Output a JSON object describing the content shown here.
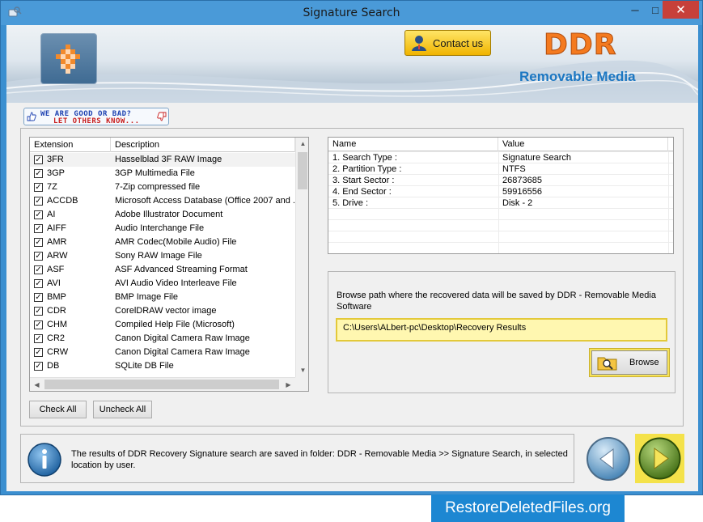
{
  "window": {
    "title": "Signature Search",
    "minimize_glyph": "─",
    "maximize_glyph": "□",
    "close_glyph": "✕"
  },
  "header": {
    "contact_label": "Contact us",
    "brand": "DDR",
    "product": "Removable Media"
  },
  "feedback": {
    "line1": "WE ARE GOOD OR BAD?",
    "line2": "LET OTHERS KNOW..."
  },
  "file_types": {
    "columns": [
      "Extension",
      "Description"
    ],
    "rows": [
      {
        "ext": "3FR",
        "desc": "Hasselblad 3F RAW Image",
        "checked": true
      },
      {
        "ext": "3GP",
        "desc": "3GP Multimedia File",
        "checked": true
      },
      {
        "ext": "7Z",
        "desc": "7-Zip compressed file",
        "checked": true
      },
      {
        "ext": "ACCDB",
        "desc": "Microsoft Access Database (Office 2007 and ...",
        "checked": true
      },
      {
        "ext": "AI",
        "desc": "Adobe Illustrator Document",
        "checked": true
      },
      {
        "ext": "AIFF",
        "desc": "Audio Interchange File",
        "checked": true
      },
      {
        "ext": "AMR",
        "desc": "AMR Codec(Mobile Audio) File",
        "checked": true
      },
      {
        "ext": "ARW",
        "desc": "Sony RAW Image File",
        "checked": true
      },
      {
        "ext": "ASF",
        "desc": "ASF Advanced Streaming Format",
        "checked": true
      },
      {
        "ext": "AVI",
        "desc": "AVI Audio Video Interleave File",
        "checked": true
      },
      {
        "ext": "BMP",
        "desc": "BMP Image File",
        "checked": true
      },
      {
        "ext": "CDR",
        "desc": "CorelDRAW vector image",
        "checked": true
      },
      {
        "ext": "CHM",
        "desc": "Compiled Help File (Microsoft)",
        "checked": true
      },
      {
        "ext": "CR2",
        "desc": "Canon Digital Camera Raw Image",
        "checked": true
      },
      {
        "ext": "CRW",
        "desc": "Canon Digital Camera Raw Image",
        "checked": true
      },
      {
        "ext": "DB",
        "desc": "SQLite DB File",
        "checked": true
      }
    ],
    "check_all_label": "Check All",
    "uncheck_all_label": "Uncheck All"
  },
  "details": {
    "columns": [
      "Name",
      "Value"
    ],
    "rows": [
      {
        "name": "1. Search Type :",
        "value": "Signature Search"
      },
      {
        "name": "2. Partition Type :",
        "value": "NTFS"
      },
      {
        "name": "3. Start Sector :",
        "value": "26873685"
      },
      {
        "name": "4. End Sector :",
        "value": "59916556"
      },
      {
        "name": "5. Drive :",
        "value": "Disk - 2"
      }
    ]
  },
  "save_path": {
    "label": "Browse path where the recovered data will be saved by DDR - Removable Media Software",
    "value": "C:\\Users\\ALbert-pc\\Desktop\\Recovery Results",
    "browse_label": "Browse"
  },
  "status": {
    "message": "The results of DDR Recovery Signature search are saved in folder: DDR - Removable Media  >> Signature Search, in selected location by user."
  },
  "footer": {
    "site": "RestoreDeletedFiles.org"
  },
  "colors": {
    "brand_orange": "#f47a1f",
    "brand_blue": "#1c77c2",
    "highlight_yellow": "#f4e24a",
    "window_blue": "#3b8fd0"
  }
}
